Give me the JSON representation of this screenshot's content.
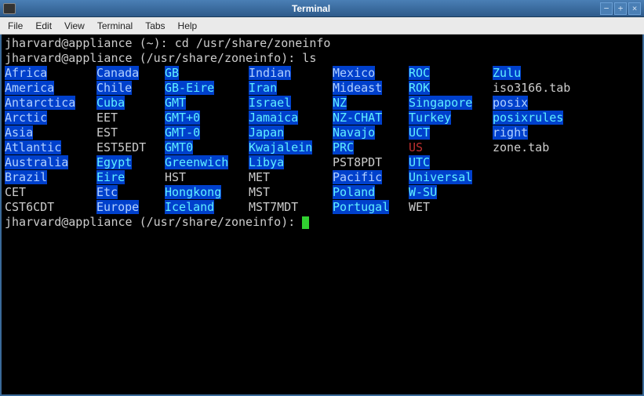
{
  "window": {
    "title": "Terminal",
    "minimize": "−",
    "maximize": "+",
    "close": "×"
  },
  "menu": {
    "file": "File",
    "edit": "Edit",
    "view": "View",
    "terminal": "Terminal",
    "tabs": "Tabs",
    "help": "Help"
  },
  "prompt1_user": "jharvard@appliance (~): ",
  "prompt1_cmd": "cd /usr/share/zoneinfo",
  "prompt2_user": "jharvard@appliance (/usr/share/zoneinfo): ",
  "prompt2_cmd": "ls",
  "prompt3_user": "jharvard@appliance (/usr/share/zoneinfo): ",
  "listing": [
    [
      {
        "t": "Africa",
        "c": "dir"
      },
      {
        "t": "Canada",
        "c": "dir"
      },
      {
        "t": "GB",
        "c": "sym"
      },
      {
        "t": "Indian",
        "c": "dir"
      },
      {
        "t": "Mexico",
        "c": "dir"
      },
      {
        "t": "ROC",
        "c": "sym"
      },
      {
        "t": "Zulu",
        "c": "sym"
      }
    ],
    [
      {
        "t": "America",
        "c": "dir"
      },
      {
        "t": "Chile",
        "c": "dir"
      },
      {
        "t": "GB-Eire",
        "c": "sym"
      },
      {
        "t": "Iran",
        "c": "sym"
      },
      {
        "t": "Mideast",
        "c": "dir"
      },
      {
        "t": "ROK",
        "c": "sym"
      },
      {
        "t": "iso3166.tab",
        "c": "plain"
      }
    ],
    [
      {
        "t": "Antarctica",
        "c": "dir"
      },
      {
        "t": "Cuba",
        "c": "sym"
      },
      {
        "t": "GMT",
        "c": "sym"
      },
      {
        "t": "Israel",
        "c": "sym"
      },
      {
        "t": "NZ",
        "c": "sym"
      },
      {
        "t": "Singapore",
        "c": "sym"
      },
      {
        "t": "posix",
        "c": "dir"
      }
    ],
    [
      {
        "t": "Arctic",
        "c": "dir"
      },
      {
        "t": "EET",
        "c": "plain"
      },
      {
        "t": "GMT+0",
        "c": "sym"
      },
      {
        "t": "Jamaica",
        "c": "sym"
      },
      {
        "t": "NZ-CHAT",
        "c": "sym"
      },
      {
        "t": "Turkey",
        "c": "sym"
      },
      {
        "t": "posixrules",
        "c": "sym"
      }
    ],
    [
      {
        "t": "Asia",
        "c": "dir"
      },
      {
        "t": "EST",
        "c": "plain"
      },
      {
        "t": "GMT-0",
        "c": "sym"
      },
      {
        "t": "Japan",
        "c": "sym"
      },
      {
        "t": "Navajo",
        "c": "sym"
      },
      {
        "t": "UCT",
        "c": "sym"
      },
      {
        "t": "right",
        "c": "dir"
      }
    ],
    [
      {
        "t": "Atlantic",
        "c": "dir"
      },
      {
        "t": "EST5EDT",
        "c": "plain"
      },
      {
        "t": "GMT0",
        "c": "sym"
      },
      {
        "t": "Kwajalein",
        "c": "sym"
      },
      {
        "t": "PRC",
        "c": "sym"
      },
      {
        "t": "US",
        "c": "link"
      },
      {
        "t": "zone.tab",
        "c": "plain"
      }
    ],
    [
      {
        "t": "Australia",
        "c": "dir"
      },
      {
        "t": "Egypt",
        "c": "sym"
      },
      {
        "t": "Greenwich",
        "c": "sym"
      },
      {
        "t": "Libya",
        "c": "sym"
      },
      {
        "t": "PST8PDT",
        "c": "plain"
      },
      {
        "t": "UTC",
        "c": "sym"
      },
      null
    ],
    [
      {
        "t": "Brazil",
        "c": "dir"
      },
      {
        "t": "Eire",
        "c": "sym"
      },
      {
        "t": "HST",
        "c": "plain"
      },
      {
        "t": "MET",
        "c": "plain"
      },
      {
        "t": "Pacific",
        "c": "dir"
      },
      {
        "t": "Universal",
        "c": "sym"
      },
      null
    ],
    [
      {
        "t": "CET",
        "c": "plain"
      },
      {
        "t": "Etc",
        "c": "dir"
      },
      {
        "t": "Hongkong",
        "c": "sym"
      },
      {
        "t": "MST",
        "c": "plain"
      },
      {
        "t": "Poland",
        "c": "sym"
      },
      {
        "t": "W-SU",
        "c": "sym"
      },
      null
    ],
    [
      {
        "t": "CST6CDT",
        "c": "plain"
      },
      {
        "t": "Europe",
        "c": "dir"
      },
      {
        "t": "Iceland",
        "c": "sym"
      },
      {
        "t": "MST7MDT",
        "c": "plain"
      },
      {
        "t": "Portugal",
        "c": "sym"
      },
      {
        "t": "WET",
        "c": "plain"
      },
      null
    ]
  ]
}
